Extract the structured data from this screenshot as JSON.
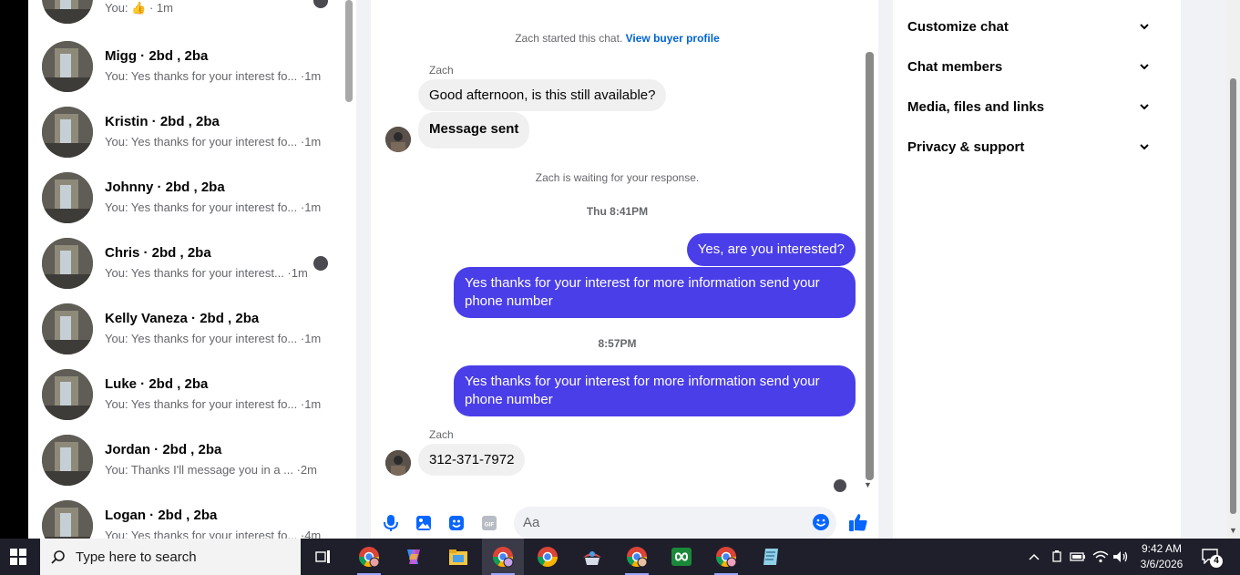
{
  "conversations": [
    {
      "name": "",
      "preview": "You: 👍 · 1m",
      "has_read_avatar": true
    },
    {
      "name": "Migg · 2bd , 2ba",
      "preview": "You: Yes thanks for your interest fo... ·1m",
      "has_read_avatar": false
    },
    {
      "name": "Kristin · 2bd , 2ba",
      "preview": "You: Yes thanks for your interest fo... ·1m",
      "has_read_avatar": false
    },
    {
      "name": "Johnny · 2bd , 2ba",
      "preview": "You: Yes thanks for your interest fo... ·1m",
      "has_read_avatar": false
    },
    {
      "name": "Chris · 2bd , 2ba",
      "preview": "You: Yes thanks for your interest... ·1m",
      "has_read_avatar": true
    },
    {
      "name": "Kelly Vaneza · 2bd , 2ba",
      "preview": "You: Yes thanks for your interest fo... ·1m",
      "has_read_avatar": false
    },
    {
      "name": "Luke · 2bd , 2ba",
      "preview": "You: Yes thanks for your interest fo... ·1m",
      "has_read_avatar": false
    },
    {
      "name": "Jordan · 2bd , 2ba",
      "preview": "You: Thanks I'll message you in a ...   ·2m",
      "has_read_avatar": false
    },
    {
      "name": "Logan · 2bd , 2ba",
      "preview": "You: Yes thanks for your interest fo... ·4m",
      "has_read_avatar": false
    }
  ],
  "chat": {
    "started_text": "Zach started this chat.",
    "view_profile_link": "View buyer profile",
    "sender_name": "Zach",
    "msg_in_1": "Good afternoon, is this still available?",
    "msg_in_2": "Message sent",
    "waiting_text": "Zach is waiting for your response.",
    "time_1": "Thu 8:41PM",
    "msg_out_1": "Yes, are you interested?",
    "msg_out_2": "Yes thanks for your interest for more information send your phone number",
    "time_2": "8:57PM",
    "msg_out_3": "Yes thanks for your interest for more information send your phone number",
    "sender_name_2": "Zach",
    "msg_in_3": "312-371-7972",
    "composer_placeholder": "Aa"
  },
  "right_panel": {
    "items": [
      "Customize chat",
      "Chat members",
      "Media, files and links",
      "Privacy & support"
    ]
  },
  "taskbar": {
    "search_placeholder": "Type here to search",
    "time": "9:42 AM",
    "date": "3/6/2026",
    "notification_count": "4"
  },
  "colors": {
    "outgoing_bubble": "#4a3ee8",
    "link": "#0064d1",
    "icon_accent": "#0866ff"
  }
}
